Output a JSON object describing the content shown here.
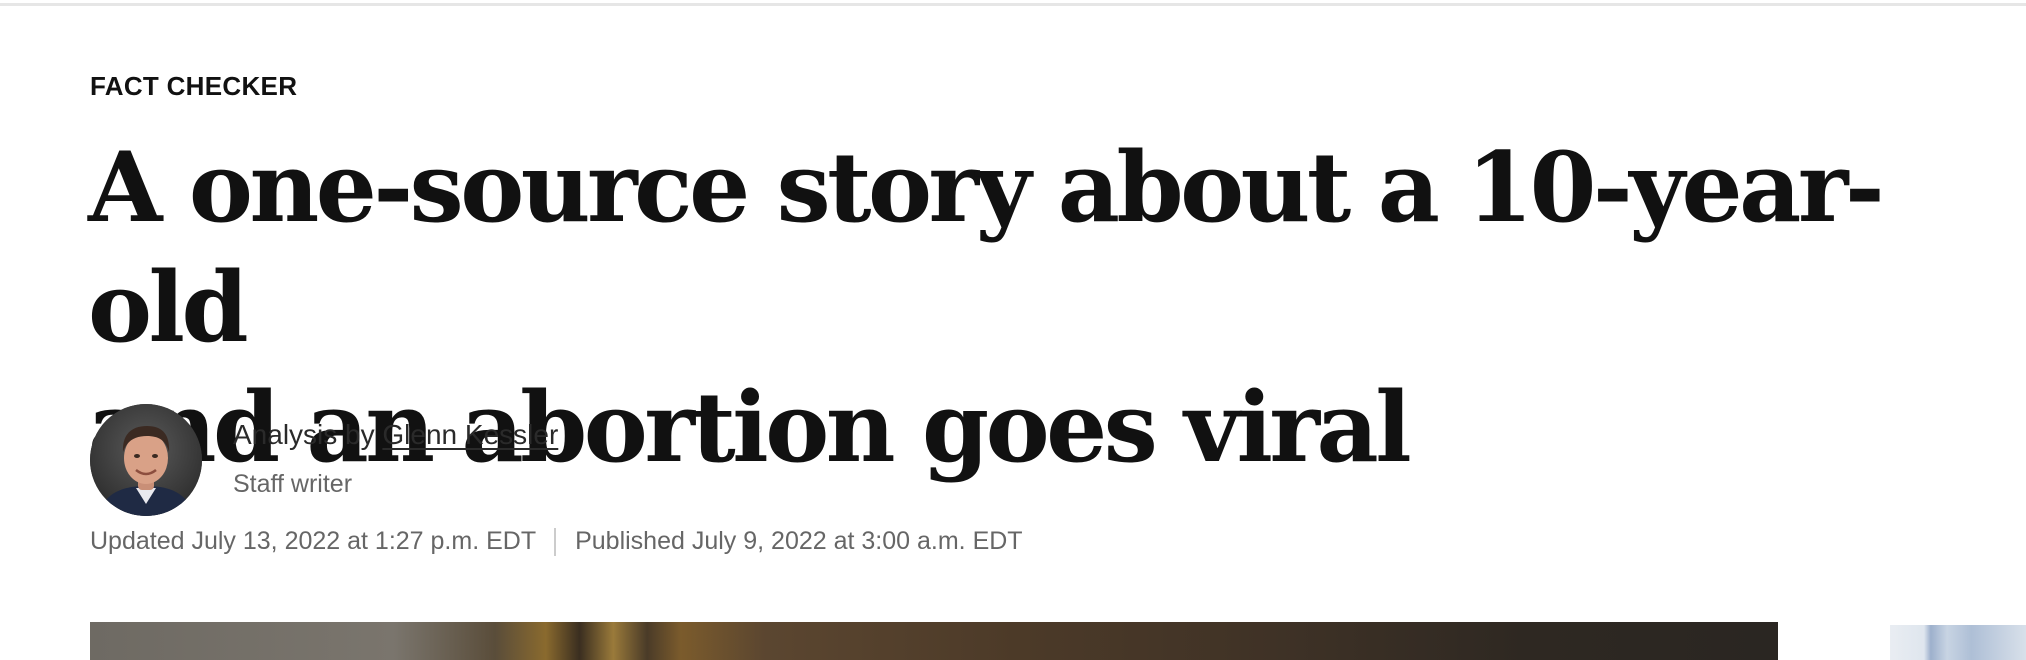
{
  "article": {
    "kicker": "FACT CHECKER",
    "headline_line1": "A one-source story about a 10-year-old",
    "headline_line2": "and an abortion goes viral",
    "byline_prefix": "Analysis by ",
    "author_name": "Glenn Kessler",
    "author_role": "Staff writer",
    "updated": "Updated July 13, 2022 at 1:27 p.m. EDT",
    "published": "Published July 9, 2022 at 3:00 a.m. EDT"
  },
  "icons": {
    "avatar": "author-photo"
  },
  "colors": {
    "text": "#111111",
    "meta": "#666666",
    "divider": "#cccccc"
  }
}
